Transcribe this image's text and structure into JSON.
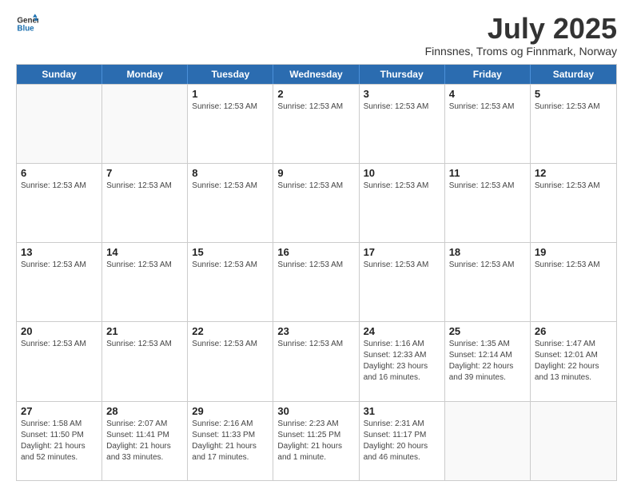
{
  "logo": {
    "line1": "General",
    "line2": "Blue"
  },
  "title": "July 2025",
  "location": "Finnsnes, Troms og Finnmark, Norway",
  "weekdays": [
    "Sunday",
    "Monday",
    "Tuesday",
    "Wednesday",
    "Thursday",
    "Friday",
    "Saturday"
  ],
  "weeks": [
    [
      {
        "day": "",
        "info": ""
      },
      {
        "day": "",
        "info": ""
      },
      {
        "day": "1",
        "info": "Sunrise: 12:53 AM"
      },
      {
        "day": "2",
        "info": "Sunrise: 12:53 AM"
      },
      {
        "day": "3",
        "info": "Sunrise: 12:53 AM"
      },
      {
        "day": "4",
        "info": "Sunrise: 12:53 AM"
      },
      {
        "day": "5",
        "info": "Sunrise: 12:53 AM"
      }
    ],
    [
      {
        "day": "6",
        "info": "Sunrise: 12:53 AM"
      },
      {
        "day": "7",
        "info": "Sunrise: 12:53 AM"
      },
      {
        "day": "8",
        "info": "Sunrise: 12:53 AM"
      },
      {
        "day": "9",
        "info": "Sunrise: 12:53 AM"
      },
      {
        "day": "10",
        "info": "Sunrise: 12:53 AM"
      },
      {
        "day": "11",
        "info": "Sunrise: 12:53 AM"
      },
      {
        "day": "12",
        "info": "Sunrise: 12:53 AM"
      }
    ],
    [
      {
        "day": "13",
        "info": "Sunrise: 12:53 AM"
      },
      {
        "day": "14",
        "info": "Sunrise: 12:53 AM"
      },
      {
        "day": "15",
        "info": "Sunrise: 12:53 AM"
      },
      {
        "day": "16",
        "info": "Sunrise: 12:53 AM"
      },
      {
        "day": "17",
        "info": "Sunrise: 12:53 AM"
      },
      {
        "day": "18",
        "info": "Sunrise: 12:53 AM"
      },
      {
        "day": "19",
        "info": "Sunrise: 12:53 AM"
      }
    ],
    [
      {
        "day": "20",
        "info": "Sunrise: 12:53 AM"
      },
      {
        "day": "21",
        "info": "Sunrise: 12:53 AM"
      },
      {
        "day": "22",
        "info": "Sunrise: 12:53 AM"
      },
      {
        "day": "23",
        "info": "Sunrise: 12:53 AM"
      },
      {
        "day": "24",
        "info": "Sunrise: 1:16 AM\nSunset: 12:33 AM\nDaylight: 23 hours and 16 minutes."
      },
      {
        "day": "25",
        "info": "Sunrise: 1:35 AM\nSunset: 12:14 AM\nDaylight: 22 hours and 39 minutes."
      },
      {
        "day": "26",
        "info": "Sunrise: 1:47 AM\nSunset: 12:01 AM\nDaylight: 22 hours and 13 minutes."
      }
    ],
    [
      {
        "day": "27",
        "info": "Sunrise: 1:58 AM\nSunset: 11:50 PM\nDaylight: 21 hours and 52 minutes."
      },
      {
        "day": "28",
        "info": "Sunrise: 2:07 AM\nSunset: 11:41 PM\nDaylight: 21 hours and 33 minutes."
      },
      {
        "day": "29",
        "info": "Sunrise: 2:16 AM\nSunset: 11:33 PM\nDaylight: 21 hours and 17 minutes."
      },
      {
        "day": "30",
        "info": "Sunrise: 2:23 AM\nSunset: 11:25 PM\nDaylight: 21 hours and 1 minute."
      },
      {
        "day": "31",
        "info": "Sunrise: 2:31 AM\nSunset: 11:17 PM\nDaylight: 20 hours and 46 minutes."
      },
      {
        "day": "",
        "info": ""
      },
      {
        "day": "",
        "info": ""
      }
    ]
  ]
}
